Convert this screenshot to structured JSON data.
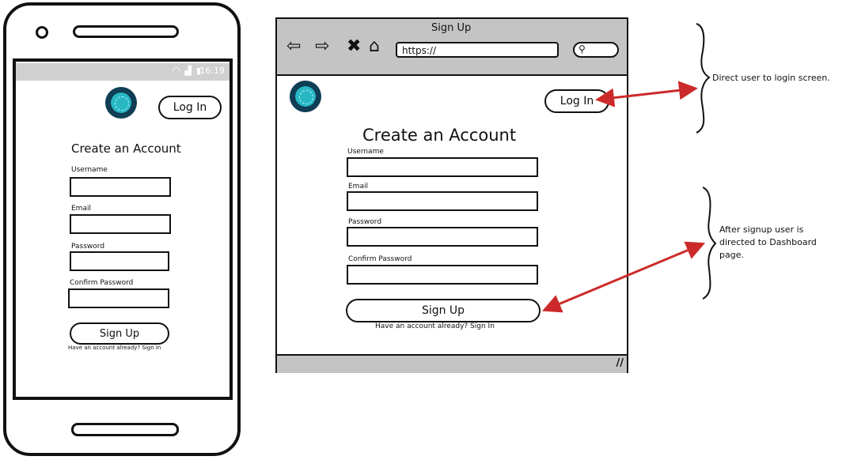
{
  "phone": {
    "status_time": "16:19",
    "login_label": "Log In",
    "heading": "Create an Account",
    "fields": [
      {
        "label": "Username"
      },
      {
        "label": "Email"
      },
      {
        "label": "Password"
      },
      {
        "label": "Confirm Password"
      }
    ],
    "signup_label": "Sign Up",
    "footer_text": "Have an account already? Sign In"
  },
  "browser": {
    "window_title": "Sign Up",
    "url_text": "https://",
    "login_label": "Log In",
    "heading": "Create an Account",
    "fields": [
      {
        "label": "Username"
      },
      {
        "label": "Email"
      },
      {
        "label": "Password"
      },
      {
        "label": "Confirm Password"
      }
    ],
    "signup_label": "Sign Up",
    "footer_text": "Have an account already? Sign In"
  },
  "annotations": {
    "login_note": "Direct user to login screen.",
    "signup_note": "After signup user is directed to Dashboard page."
  },
  "colors": {
    "arrow": "#cc2a2a",
    "chrome": "#c4c4c4",
    "logo_inner": "#27b8c4",
    "logo_outer": "#0f3e55"
  }
}
